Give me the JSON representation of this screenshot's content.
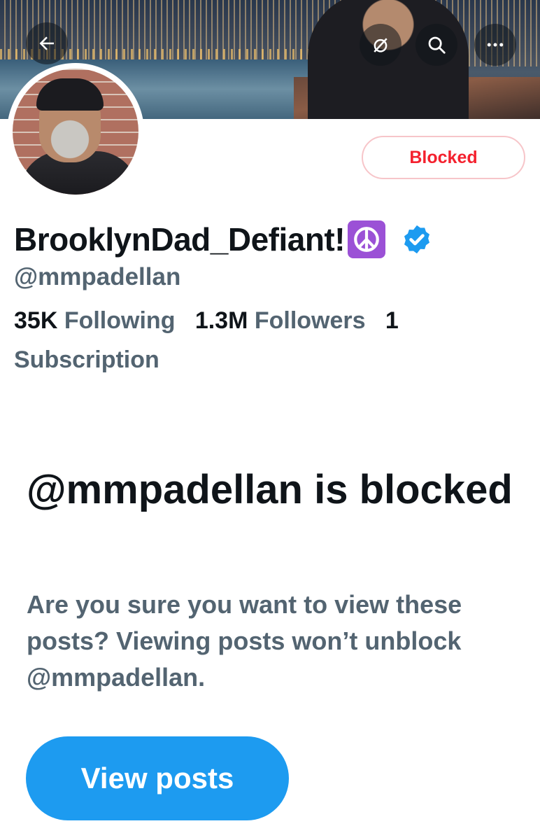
{
  "header": {
    "back_icon": "arrow-left-icon",
    "notifications_icon": "bell-slash-icon",
    "search_icon": "search-icon",
    "more_icon": "more-horizontal-icon"
  },
  "profile": {
    "display_name": "BrooklynDad_Defiant!",
    "emoji": "peace-symbol",
    "verified": true,
    "handle": "@mmpadellan",
    "following_count": "35K",
    "following_label": "Following",
    "followers_count": "1.3M",
    "followers_label": "Followers",
    "subscription_count": "1",
    "subscription_label": "Subscription",
    "blocked_button": "Blocked"
  },
  "blocked_notice": {
    "title": "@mmpadellan is blocked",
    "description": "Are you sure you want to view these posts? Viewing posts won’t unblock @mmpadellan.",
    "button": "View posts"
  },
  "colors": {
    "accent": "#1d9bf0",
    "blocked_red": "#f4212e",
    "secondary_text": "#536471",
    "peace_purple": "#9b51d6"
  }
}
